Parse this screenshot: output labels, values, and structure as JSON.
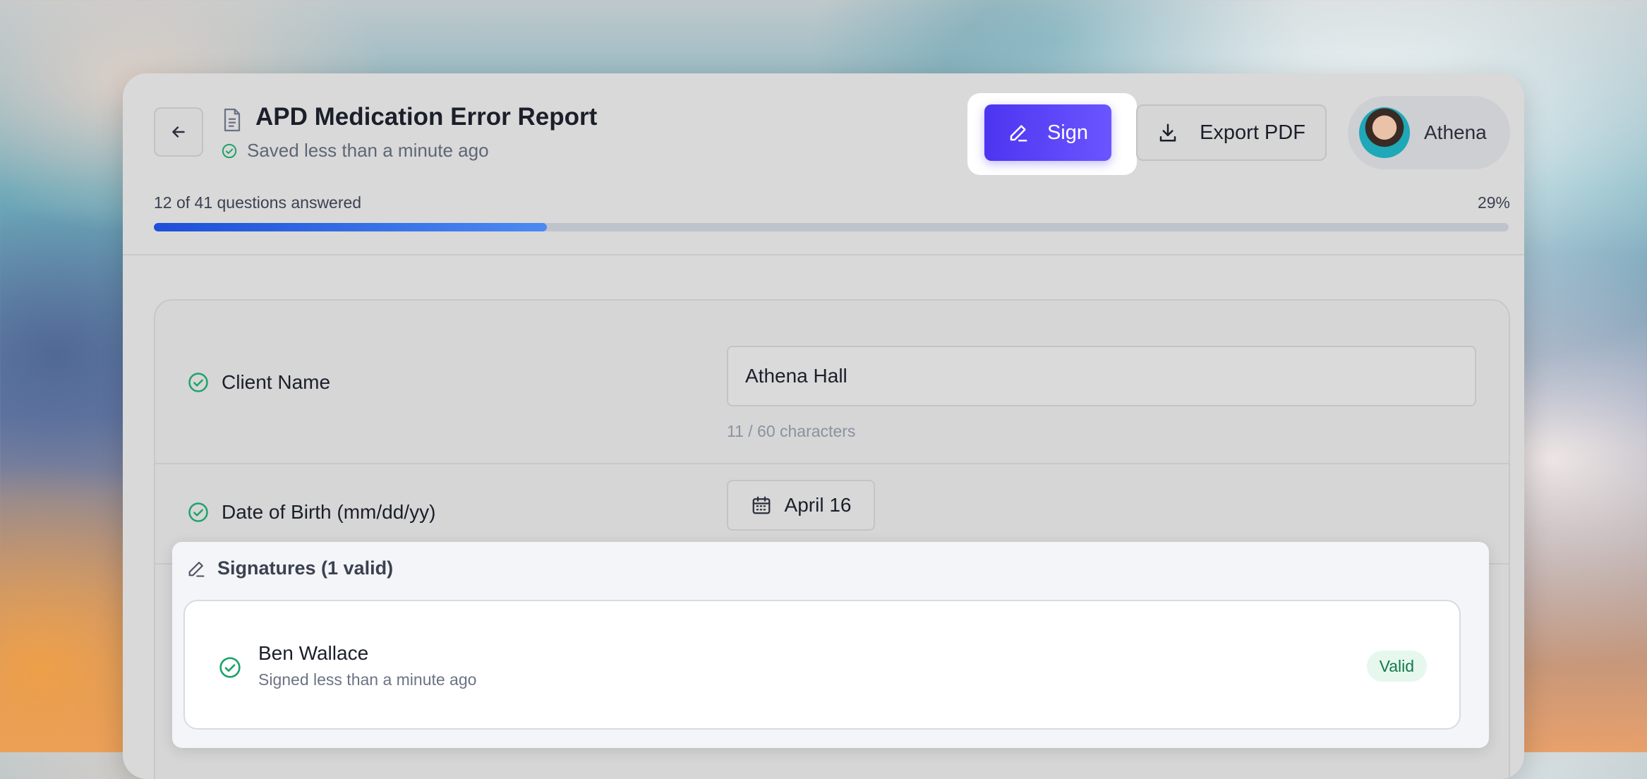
{
  "header": {
    "title": "APD Medication Error Report",
    "saved_status": "Saved less than a minute ago",
    "sign_label": "Sign",
    "export_label": "Export PDF",
    "user_name": "Athena"
  },
  "progress": {
    "label": "12 of 41 questions answered",
    "percent_text": "29%",
    "answered": 12,
    "total": 41
  },
  "form": {
    "client_name": {
      "label": "Client Name",
      "value": "Athena Hall",
      "char_count": "11 / 60 characters"
    },
    "dob": {
      "label": "Date of Birth (mm/dd/yy)",
      "value": "April 16"
    }
  },
  "signatures": {
    "header": "Signatures (1 valid)",
    "items": [
      {
        "name": "Ben Wallace",
        "time": "Signed less than a minute ago",
        "status": "Valid"
      }
    ]
  },
  "colors": {
    "accent": "#4d35f0",
    "success": "#1fa36a",
    "progress": "#2563eb"
  }
}
